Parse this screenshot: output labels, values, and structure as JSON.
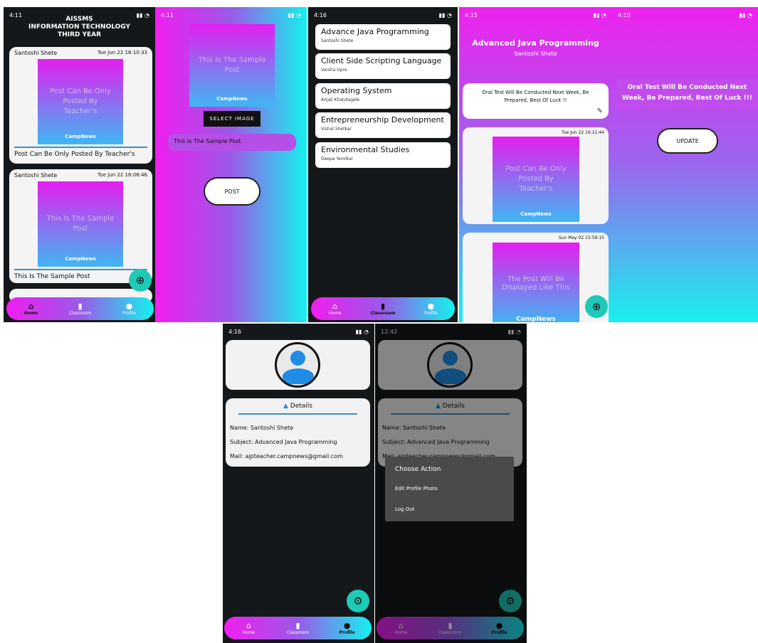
{
  "status_times": [
    "4:11",
    "4:11",
    "4:16",
    "4:15",
    "4:15",
    "4:16",
    "12:42"
  ],
  "s1": {
    "header": [
      "AISSMS",
      "INFORMATION TECHNOLOGY",
      "THIRD YEAR"
    ],
    "posts": [
      {
        "author": "Santoshi Shete",
        "date": "Tue Jun 22 16:10:33",
        "img_text": "Post Can Be Only Posted By Teacher's",
        "brand": "CampNews",
        "caption": "Post Can Be Only Posted By Teacher's"
      },
      {
        "author": "Santoshi Shete",
        "date": "Tue Jun 22 16:06:46",
        "img_text": "This Is The Sample Post",
        "brand": "CampNews",
        "caption": "This Is The Sample Post"
      }
    ]
  },
  "s2": {
    "img_text": "This Is The Sample Post",
    "brand": "CampNews",
    "select_label": "SELECT IMAGE",
    "input_value": "This Is The Sample Post",
    "post_label": "POST"
  },
  "s3": {
    "subjects": [
      {
        "name": "Advance Java Programming",
        "teacher": "Santoshi Shete"
      },
      {
        "name": "Client Side Scripting Language",
        "teacher": "Varsha Upre"
      },
      {
        "name": "Operating System",
        "teacher": "Anjali Khandagale"
      },
      {
        "name": "Entrepreneurship Development",
        "teacher": "Vishal Shetkar"
      },
      {
        "name": "Environmental Studies",
        "teacher": "Deepa Yerolkar"
      }
    ]
  },
  "s4": {
    "title": "Advanced Java Programming",
    "teacher": "Santoshi Shete",
    "notice": "Oral Test Will Be Conducted Next Week, Be Prepared, Best Of Luck !!",
    "posts": [
      {
        "date": "Tue Jun 22 16:11:44",
        "img_text": "Post Can Be Only Posted By Teacher's",
        "brand": "CampNews"
      },
      {
        "date": "Sun May 02 15:58:15",
        "img_text": "The Post Will Be Displayed Like This",
        "brand": "CampNews"
      }
    ]
  },
  "s5": {
    "notice": "Oral Test Will Be Conducted Next Week, Be Prepared, Best Of Luck !!!",
    "update_label": "UPDATE"
  },
  "profile": {
    "details_title": "Details",
    "name": "Name: Santoshi Shete",
    "subject": "Subject: Advanced Java Programming",
    "mail": "Mail: ajpteacher.campnews@gmail.com"
  },
  "dialog": {
    "title": "Choose Action",
    "options": [
      "Edit Profile Photo",
      "Log Out"
    ]
  },
  "nav": {
    "home": "Home",
    "classroom": "Classroom",
    "profile": "Profile"
  },
  "colors": {
    "accent_teal": "#1fc9b7",
    "avatar_blue": "#1f8ce6",
    "grad_pink": "#f01ef0",
    "grad_cyan": "#15f1ee"
  }
}
